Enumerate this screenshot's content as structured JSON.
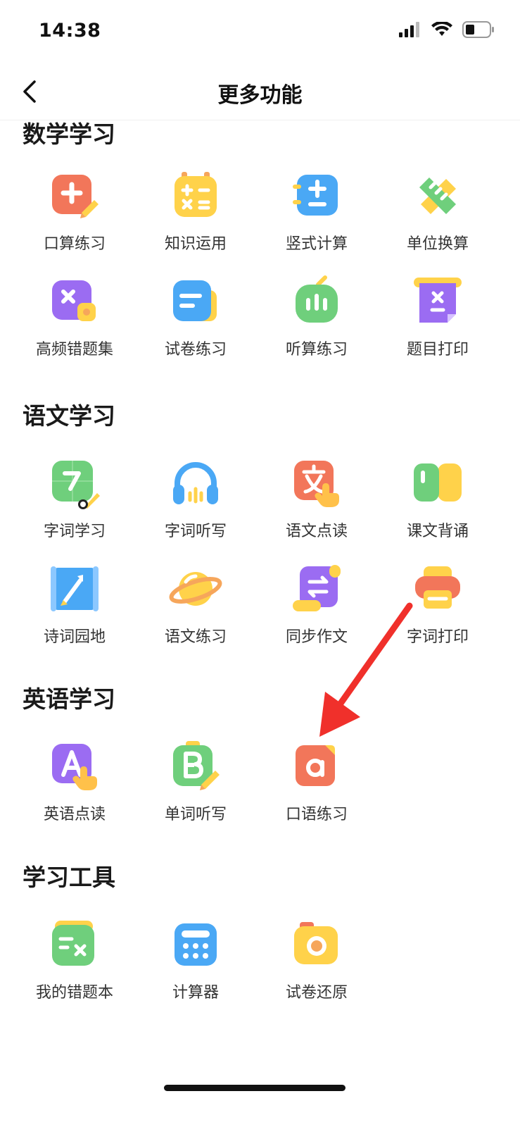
{
  "status_bar": {
    "time": "14:38"
  },
  "nav": {
    "title": "更多功能"
  },
  "sections": [
    {
      "title": "数学学习",
      "items": [
        {
          "label": "口算练习",
          "icon": "plus-pencil-icon"
        },
        {
          "label": "知识运用",
          "icon": "calculator-sign-icon"
        },
        {
          "label": "竖式计算",
          "icon": "vertical-calc-icon"
        },
        {
          "label": "单位换算",
          "icon": "ruler-icon"
        },
        {
          "label": "高频错题集",
          "icon": "x-coin-icon"
        },
        {
          "label": "试卷练习",
          "icon": "paper-icon"
        },
        {
          "label": "听算练习",
          "icon": "audio-bars-icon"
        },
        {
          "label": "题目打印",
          "icon": "print-x-icon"
        }
      ]
    },
    {
      "title": "语文学习",
      "items": [
        {
          "label": "字词学习",
          "icon": "character-brush-icon"
        },
        {
          "label": "字词听写",
          "icon": "headphones-icon"
        },
        {
          "label": "语文点读",
          "icon": "wen-hand-icon"
        },
        {
          "label": "课文背诵",
          "icon": "book-blocks-icon"
        },
        {
          "label": "诗词园地",
          "icon": "scroll-brush-icon"
        },
        {
          "label": "语文练习",
          "icon": "planet-icon"
        },
        {
          "label": "同步作文",
          "icon": "swap-scroll-icon"
        },
        {
          "label": "字词打印",
          "icon": "printer-icon"
        }
      ]
    },
    {
      "title": "英语学习",
      "items": [
        {
          "label": "英语点读",
          "icon": "letter-a-hand-icon"
        },
        {
          "label": "单词听写",
          "icon": "letter-b-pencil-icon"
        },
        {
          "label": "口语练习",
          "icon": "letter-a-lower-icon"
        }
      ]
    },
    {
      "title": "学习工具",
      "items": [
        {
          "label": "我的错题本",
          "icon": "error-book-icon"
        },
        {
          "label": "计算器",
          "icon": "calculator-icon"
        },
        {
          "label": "试卷还原",
          "icon": "camera-icon"
        }
      ]
    }
  ],
  "colors": {
    "orange": "#F2765A",
    "yellow": "#FFD24A",
    "blue": "#4AA8F5",
    "green": "#6FCF7C",
    "purple": "#9B6CF2",
    "arrow_red": "#F0302B"
  }
}
